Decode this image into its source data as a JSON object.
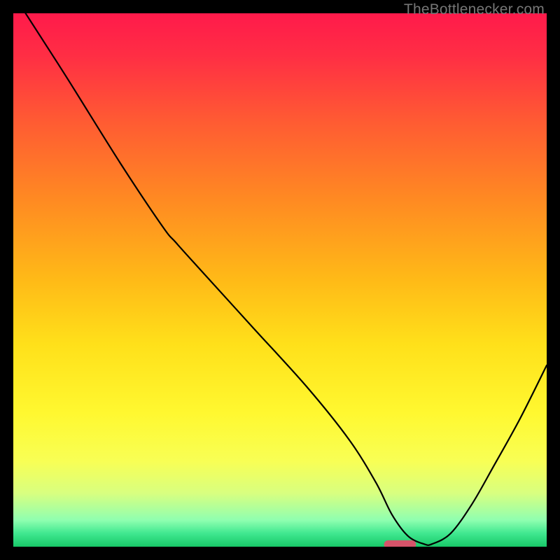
{
  "watermark": "TheBottlenecker.com",
  "chart_data": {
    "type": "line",
    "title": "",
    "xlabel": "",
    "ylabel": "",
    "xlim": [
      0,
      100
    ],
    "ylim": [
      0,
      100
    ],
    "background_gradient": {
      "stops": [
        {
          "offset": 0.0,
          "color": "#ff1a4b"
        },
        {
          "offset": 0.08,
          "color": "#ff2e44"
        },
        {
          "offset": 0.2,
          "color": "#ff5a33"
        },
        {
          "offset": 0.35,
          "color": "#ff8a22"
        },
        {
          "offset": 0.5,
          "color": "#ffba17"
        },
        {
          "offset": 0.62,
          "color": "#ffe01a"
        },
        {
          "offset": 0.75,
          "color": "#fff830"
        },
        {
          "offset": 0.84,
          "color": "#f8ff55"
        },
        {
          "offset": 0.9,
          "color": "#d8ff80"
        },
        {
          "offset": 0.95,
          "color": "#90ffb0"
        },
        {
          "offset": 0.975,
          "color": "#40e890"
        },
        {
          "offset": 1.0,
          "color": "#18c868"
        }
      ]
    },
    "series": [
      {
        "name": "bottleneck-curve",
        "x": [
          2.3,
          10,
          20,
          28,
          30.5,
          35,
          45,
          55,
          63,
          68,
          71,
          74,
          77,
          78.5,
          82,
          86,
          90,
          95,
          100
        ],
        "y": [
          100,
          88,
          72,
          60,
          57,
          52,
          41,
          30,
          20,
          12,
          6,
          2,
          0.5,
          0.5,
          2.5,
          8,
          15,
          24,
          34
        ]
      }
    ],
    "marker": {
      "shape": "capsule",
      "x_center": 72.5,
      "y": 0.4,
      "width_x": 6.0,
      "height_y": 1.6,
      "fill": "#d6546a"
    }
  }
}
